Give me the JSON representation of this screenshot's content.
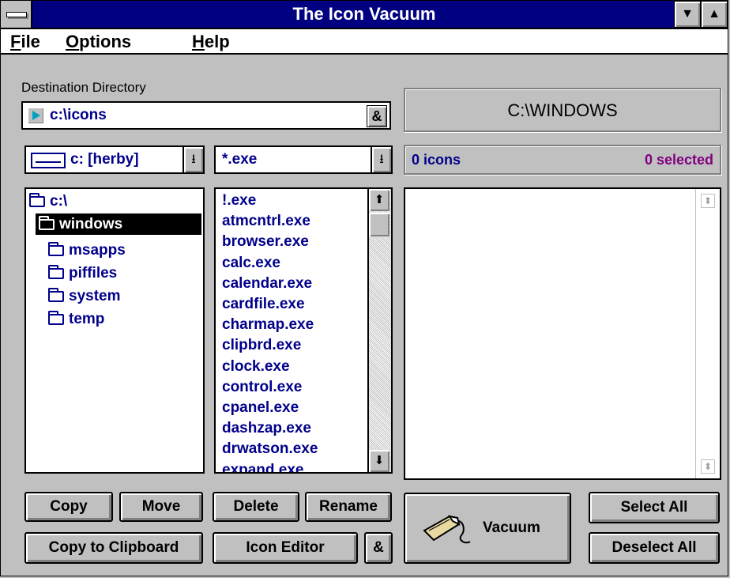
{
  "window": {
    "title": "The Icon Vacuum"
  },
  "menu": [
    {
      "label": "File",
      "accel": "F",
      "rest": "ile"
    },
    {
      "label": "Options",
      "accel": "O",
      "rest": "ptions"
    },
    {
      "label": "Help",
      "accel": "H",
      "rest": "elp"
    }
  ],
  "destination": {
    "label": "Destination Directory",
    "value": "c:\\icons",
    "browse_label": "&"
  },
  "current_dir_display": "C:\\WINDOWS",
  "drive": {
    "value": "c: [herby]"
  },
  "filter": {
    "value": "*.exe"
  },
  "status": {
    "icons": "0 icons",
    "selected": "0 selected"
  },
  "tree": {
    "root": "c:\\",
    "selected": "windows",
    "children": [
      "msapps",
      "piffiles",
      "system",
      "temp"
    ]
  },
  "files": [
    "!.exe",
    "atmcntrl.exe",
    "browser.exe",
    "calc.exe",
    "calendar.exe",
    "cardfile.exe",
    "charmap.exe",
    "clipbrd.exe",
    "clock.exe",
    "control.exe",
    "cpanel.exe",
    "dashzap.exe",
    "drwatson.exe",
    "expand.exe"
  ],
  "buttons": {
    "copy": "Copy",
    "move": "Move",
    "delete": "Delete",
    "rename": "Rename",
    "copy_clipboard": "Copy to Clipboard",
    "icon_editor": "Icon Editor",
    "icon_editor_amp": "&",
    "vacuum": "Vacuum",
    "select_all": "Select All",
    "deselect_all": "Deselect All"
  },
  "colors": {
    "title_bg": "#000080",
    "text_blue": "#00008b",
    "purple": "#800080"
  }
}
